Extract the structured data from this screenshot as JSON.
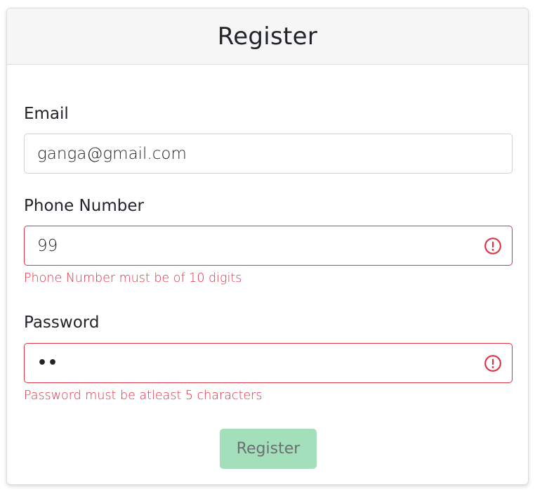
{
  "header": {
    "title": "Register"
  },
  "form": {
    "email": {
      "label": "Email",
      "value": "ganga@gmail.com"
    },
    "phone": {
      "label": "Phone Number",
      "value": "99",
      "error": "Phone Number must be of 10 digits",
      "icon": "error-circle-icon"
    },
    "password": {
      "label": "Password",
      "masked_value": "••",
      "error": "Password must be atleast 5 characters",
      "icon": "error-circle-icon"
    },
    "submit_label": "Register"
  },
  "colors": {
    "error": "#dc3545",
    "button_bg": "#a3dfbb",
    "button_text": "#6c6f70",
    "header_bg": "#f6f6f6"
  }
}
